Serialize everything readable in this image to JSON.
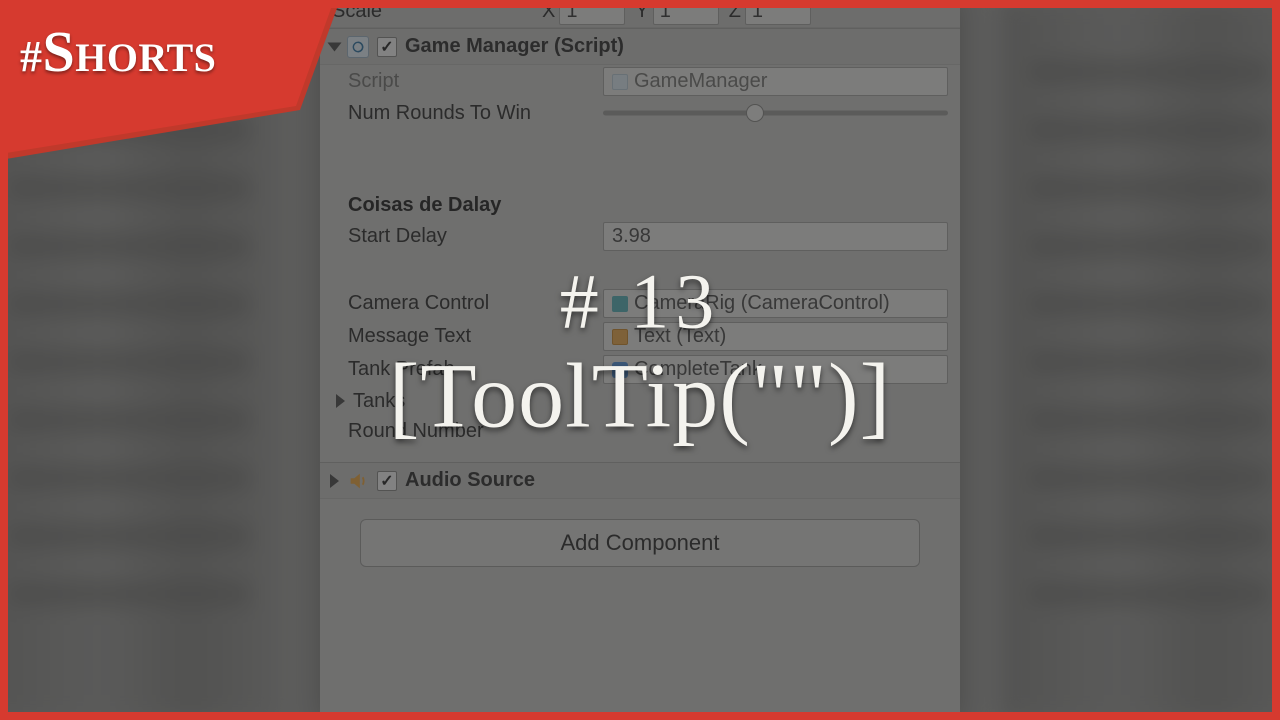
{
  "badge": {
    "hash": "#",
    "first": "S",
    "rest": "HORTS"
  },
  "scale_row": {
    "label": "Scale",
    "x_label": "X",
    "x": "1",
    "y_label": "Y",
    "y": "1",
    "z_label": "Z",
    "z": "1"
  },
  "gm": {
    "title": "Game Manager (Script)",
    "script_label": "Script",
    "script_value": "GameManager",
    "rounds_label": "Num Rounds To Win",
    "slider_pct": 44
  },
  "delay": {
    "header": "Coisas de Dalay",
    "start_label": "Start Delay",
    "start_value": "3.98"
  },
  "refs": {
    "camera_label": "Camera Control",
    "camera_value": "CameraRig (CameraControl)",
    "message_label": "Message Text",
    "message_value": "Text (Text)",
    "prefab_label": "Tank Prefab",
    "prefab_value": "CompleteTank",
    "tanks_label": "Tanks",
    "round_label": "Round Number"
  },
  "audio": {
    "title": "Audio Source"
  },
  "add_component": "Add Component",
  "overlay": {
    "num": "# 13",
    "tip": "[ToolTip(\"\")]"
  }
}
